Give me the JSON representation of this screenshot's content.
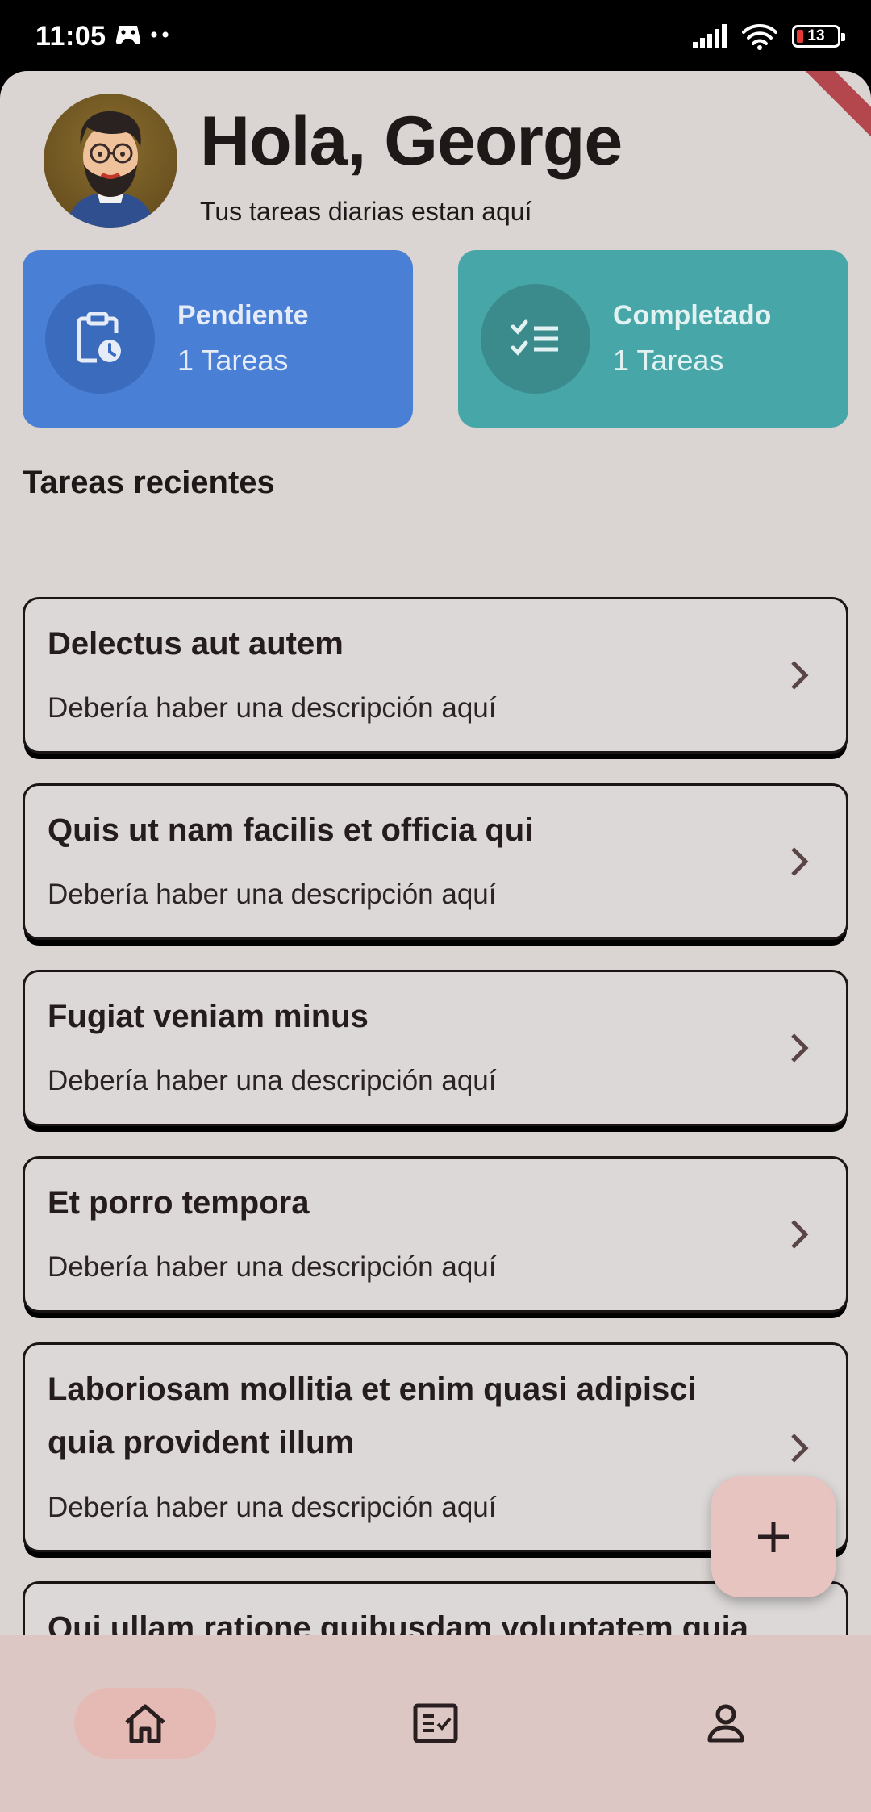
{
  "status_bar": {
    "time": "11:05",
    "battery": "13"
  },
  "header": {
    "greeting": "Hola, George",
    "subtitle": "Tus tareas diarias estan aquí"
  },
  "stats": [
    {
      "title": "Pendiente",
      "count": "1 Tareas",
      "color": "#4a7fd6",
      "icon": "clipboard-clock-icon"
    },
    {
      "title": "Completado",
      "count": "1 Tareas",
      "color": "#47a6a8",
      "icon": "checklist-icon"
    }
  ],
  "section_title": "Tareas recientes",
  "tasks": [
    {
      "title": "Delectus aut autem",
      "description": "Debería haber una descripción aquí"
    },
    {
      "title": "Quis ut nam facilis et officia qui",
      "description": "Debería haber una descripción aquí"
    },
    {
      "title": "Fugiat veniam minus",
      "description": "Debería haber una descripción aquí"
    },
    {
      "title": "Et porro tempora",
      "description": "Debería haber una descripción aquí"
    },
    {
      "title": "Laboriosam mollitia et enim quasi adipisci quia provident illum",
      "description": "Debería haber una descripción aquí"
    },
    {
      "title": "Qui ullam ratione quibusdam voluptatem quia omnis",
      "description": ""
    }
  ],
  "nav": [
    {
      "name": "home-icon",
      "active": true
    },
    {
      "name": "task-list-icon",
      "active": false
    },
    {
      "name": "profile-icon",
      "active": false
    }
  ]
}
